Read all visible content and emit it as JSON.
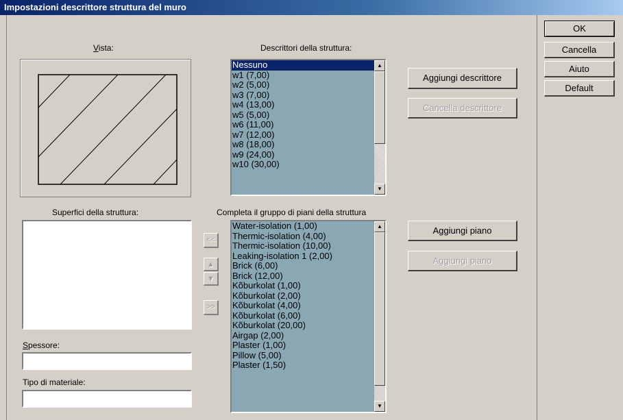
{
  "window": {
    "title": "Impostazioni descrittore struttura del muro"
  },
  "preview": {
    "label_u": "V",
    "label_rest": "ista:"
  },
  "descriptors": {
    "label": "Descrittori della struttura:",
    "items": [
      "Nessuno",
      "w1 (7,00)",
      "w2 (5,00)",
      "w3 (7,00)",
      "w4 (13,00)",
      "w5 (5,00)",
      "w6 (11,00)",
      "w7 (12,00)",
      "w8 (18,00)",
      "w9 (24,00)",
      "w10 (30,00)"
    ],
    "selected": "Nessuno",
    "add_label": "Aggiungi descrittore",
    "delete_label": "Cancella descrittore"
  },
  "surfaces": {
    "label": "Superfici della struttura:"
  },
  "layers": {
    "label": "Completa il gruppo di piani della struttura",
    "items": [
      "Water-isolation (1,00)",
      "Thermic-isolation (4,00)",
      "Thermic-isolation (10,00)",
      "Leaking-isolation 1 (2,00)",
      "Brick (6,00)",
      "Brick (12,00)",
      "Kõburkolat (1,00)",
      "Kõburkolat (2,00)",
      "Kõburkolat (4,00)",
      "Kõburkolat (6,00)",
      "Kõburkolat (20,00)",
      "Airgap (2,00)",
      "Plaster (1,00)",
      "Pillow (5,00)",
      "Plaster (1,50)"
    ],
    "add_label": "Aggiungi piano",
    "add_disabled_label": "Aggiungi piano"
  },
  "transfer": {
    "left": "<<",
    "up": "▲",
    "down": "▼",
    "right": ">>"
  },
  "thickness": {
    "label_u": "S",
    "label_rest": "pessore:",
    "value": ""
  },
  "material": {
    "label": "Tipo di materiale:",
    "value": ""
  },
  "side": {
    "ok": "OK",
    "cancel": "Cancella",
    "help": "Aiuto",
    "default": "Default"
  },
  "icons": {
    "scroll_up": "scroll-up-arrow-icon",
    "scroll_down": "scroll-down-arrow-icon"
  }
}
